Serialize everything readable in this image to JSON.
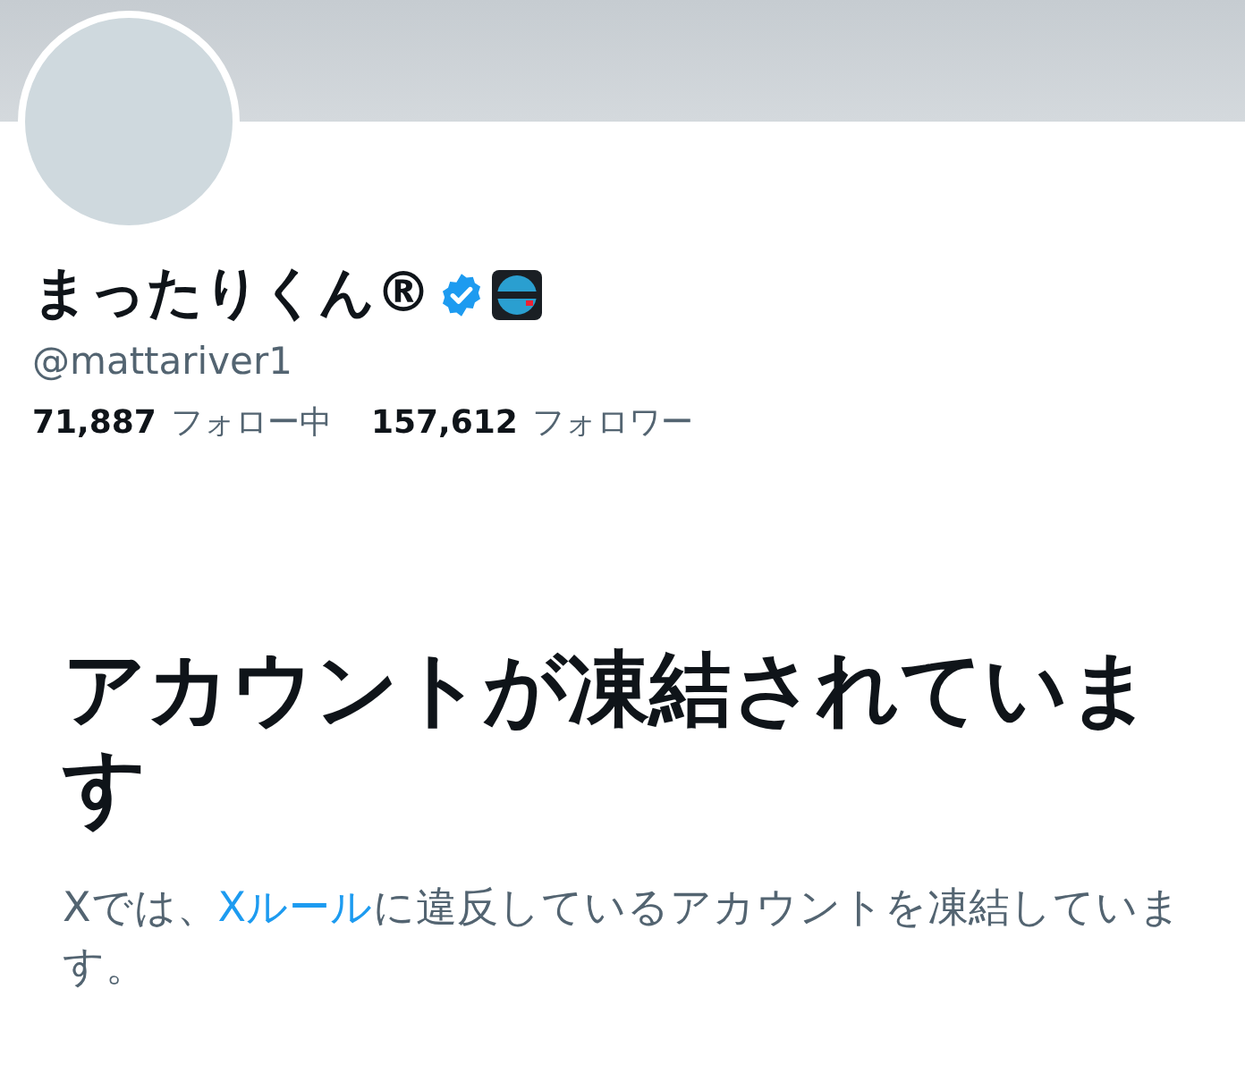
{
  "profile": {
    "display_name": "まったりくん®",
    "verified": true,
    "handle": "@mattariver1",
    "stats": [
      {
        "count": "71,887",
        "label": "フォロー中"
      },
      {
        "count": "157,612",
        "label": "フォロワー"
      }
    ]
  },
  "notice": {
    "title": "アカウントが凍結されています",
    "text_before": "Xでは、",
    "link": "Xルール",
    "text_after": "に違反しているアカウントを凍結しています。"
  }
}
